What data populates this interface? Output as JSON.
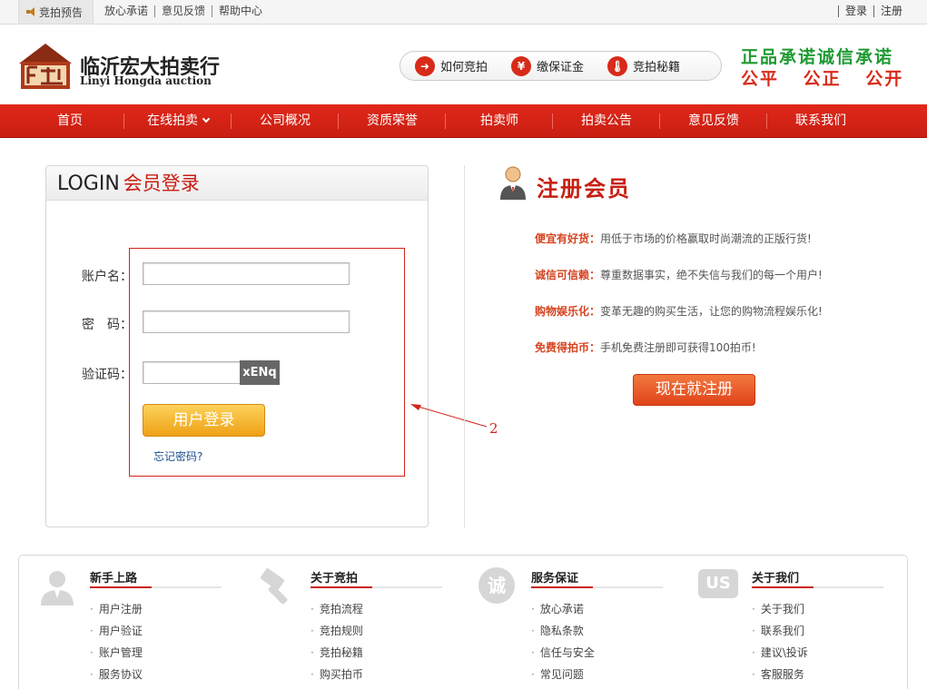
{
  "topbar": {
    "preview": "竞拍预告",
    "links": [
      "放心承诺",
      "意见反馈",
      "帮助中心"
    ],
    "login": "登录",
    "register": "注册"
  },
  "brand": {
    "name_cn": "临沂宏大拍卖行",
    "name_en": "Linyi Hongda auction"
  },
  "quicklinks": [
    {
      "label": "如何竞拍",
      "icon": "pointer-icon"
    },
    {
      "label": "缴保证金",
      "icon": "yuan-icon"
    },
    {
      "label": "竞拍秘籍",
      "icon": "thermometer-icon"
    }
  ],
  "slogan": {
    "line1": "正品承诺诚信承诺",
    "line2": "公平 公正 公开"
  },
  "nav": [
    "首页",
    "在线拍卖",
    "公司概况",
    "资质荣誉",
    "拍卖师",
    "拍卖公告",
    "意见反馈",
    "联系我们"
  ],
  "login": {
    "title_en": "LOGIN",
    "title_cn": "会员登录",
    "username_label": "账户名：",
    "password_label": "密　码：",
    "captcha_label": "验证码：",
    "captcha_text": "xENq",
    "button": "用户登录",
    "forgot": "忘记密码?"
  },
  "annotation": {
    "number": "2"
  },
  "register": {
    "title": "注册会员",
    "benefits": [
      {
        "head": "便宜有好货：",
        "text": "用低于市场的价格赢取时尚潮流的正版行货!"
      },
      {
        "head": "诚信可信赖：",
        "text": "尊重数据事实，绝不失信与我们的每一个用户!"
      },
      {
        "head": "购物娱乐化：",
        "text": "变革无趣的购买生活，让您的购物流程娱乐化!"
      },
      {
        "head": "免费得拍币：",
        "text": "手机免费注册即可获得100拍币!"
      }
    ],
    "button": "现在就注册"
  },
  "footer": {
    "columns": [
      {
        "title": "新手上路",
        "icon": "user-icon",
        "links": [
          "用户注册",
          "用户验证",
          "账户管理",
          "服务协议"
        ]
      },
      {
        "title": "关于竞拍",
        "icon": "gavel-icon",
        "links": [
          "竞拍流程",
          "竞拍规则",
          "竞拍秘籍",
          "购买拍币"
        ]
      },
      {
        "title": "服务保证",
        "icon": "integrity-icon",
        "icon_text": "诚",
        "links": [
          "放心承诺",
          "隐私条款",
          "信任与安全",
          "常见问题"
        ]
      },
      {
        "title": "关于我们",
        "icon": "us-icon",
        "icon_text": "US",
        "links": [
          "关于我们",
          "联系我们",
          "建议\\投诉",
          "客服服务"
        ]
      }
    ]
  },
  "colors": {
    "brand_red": "#c81e12",
    "slogan_green": "#1e9a32",
    "login_orange": "#efa116",
    "register_orange": "#e0431a"
  }
}
